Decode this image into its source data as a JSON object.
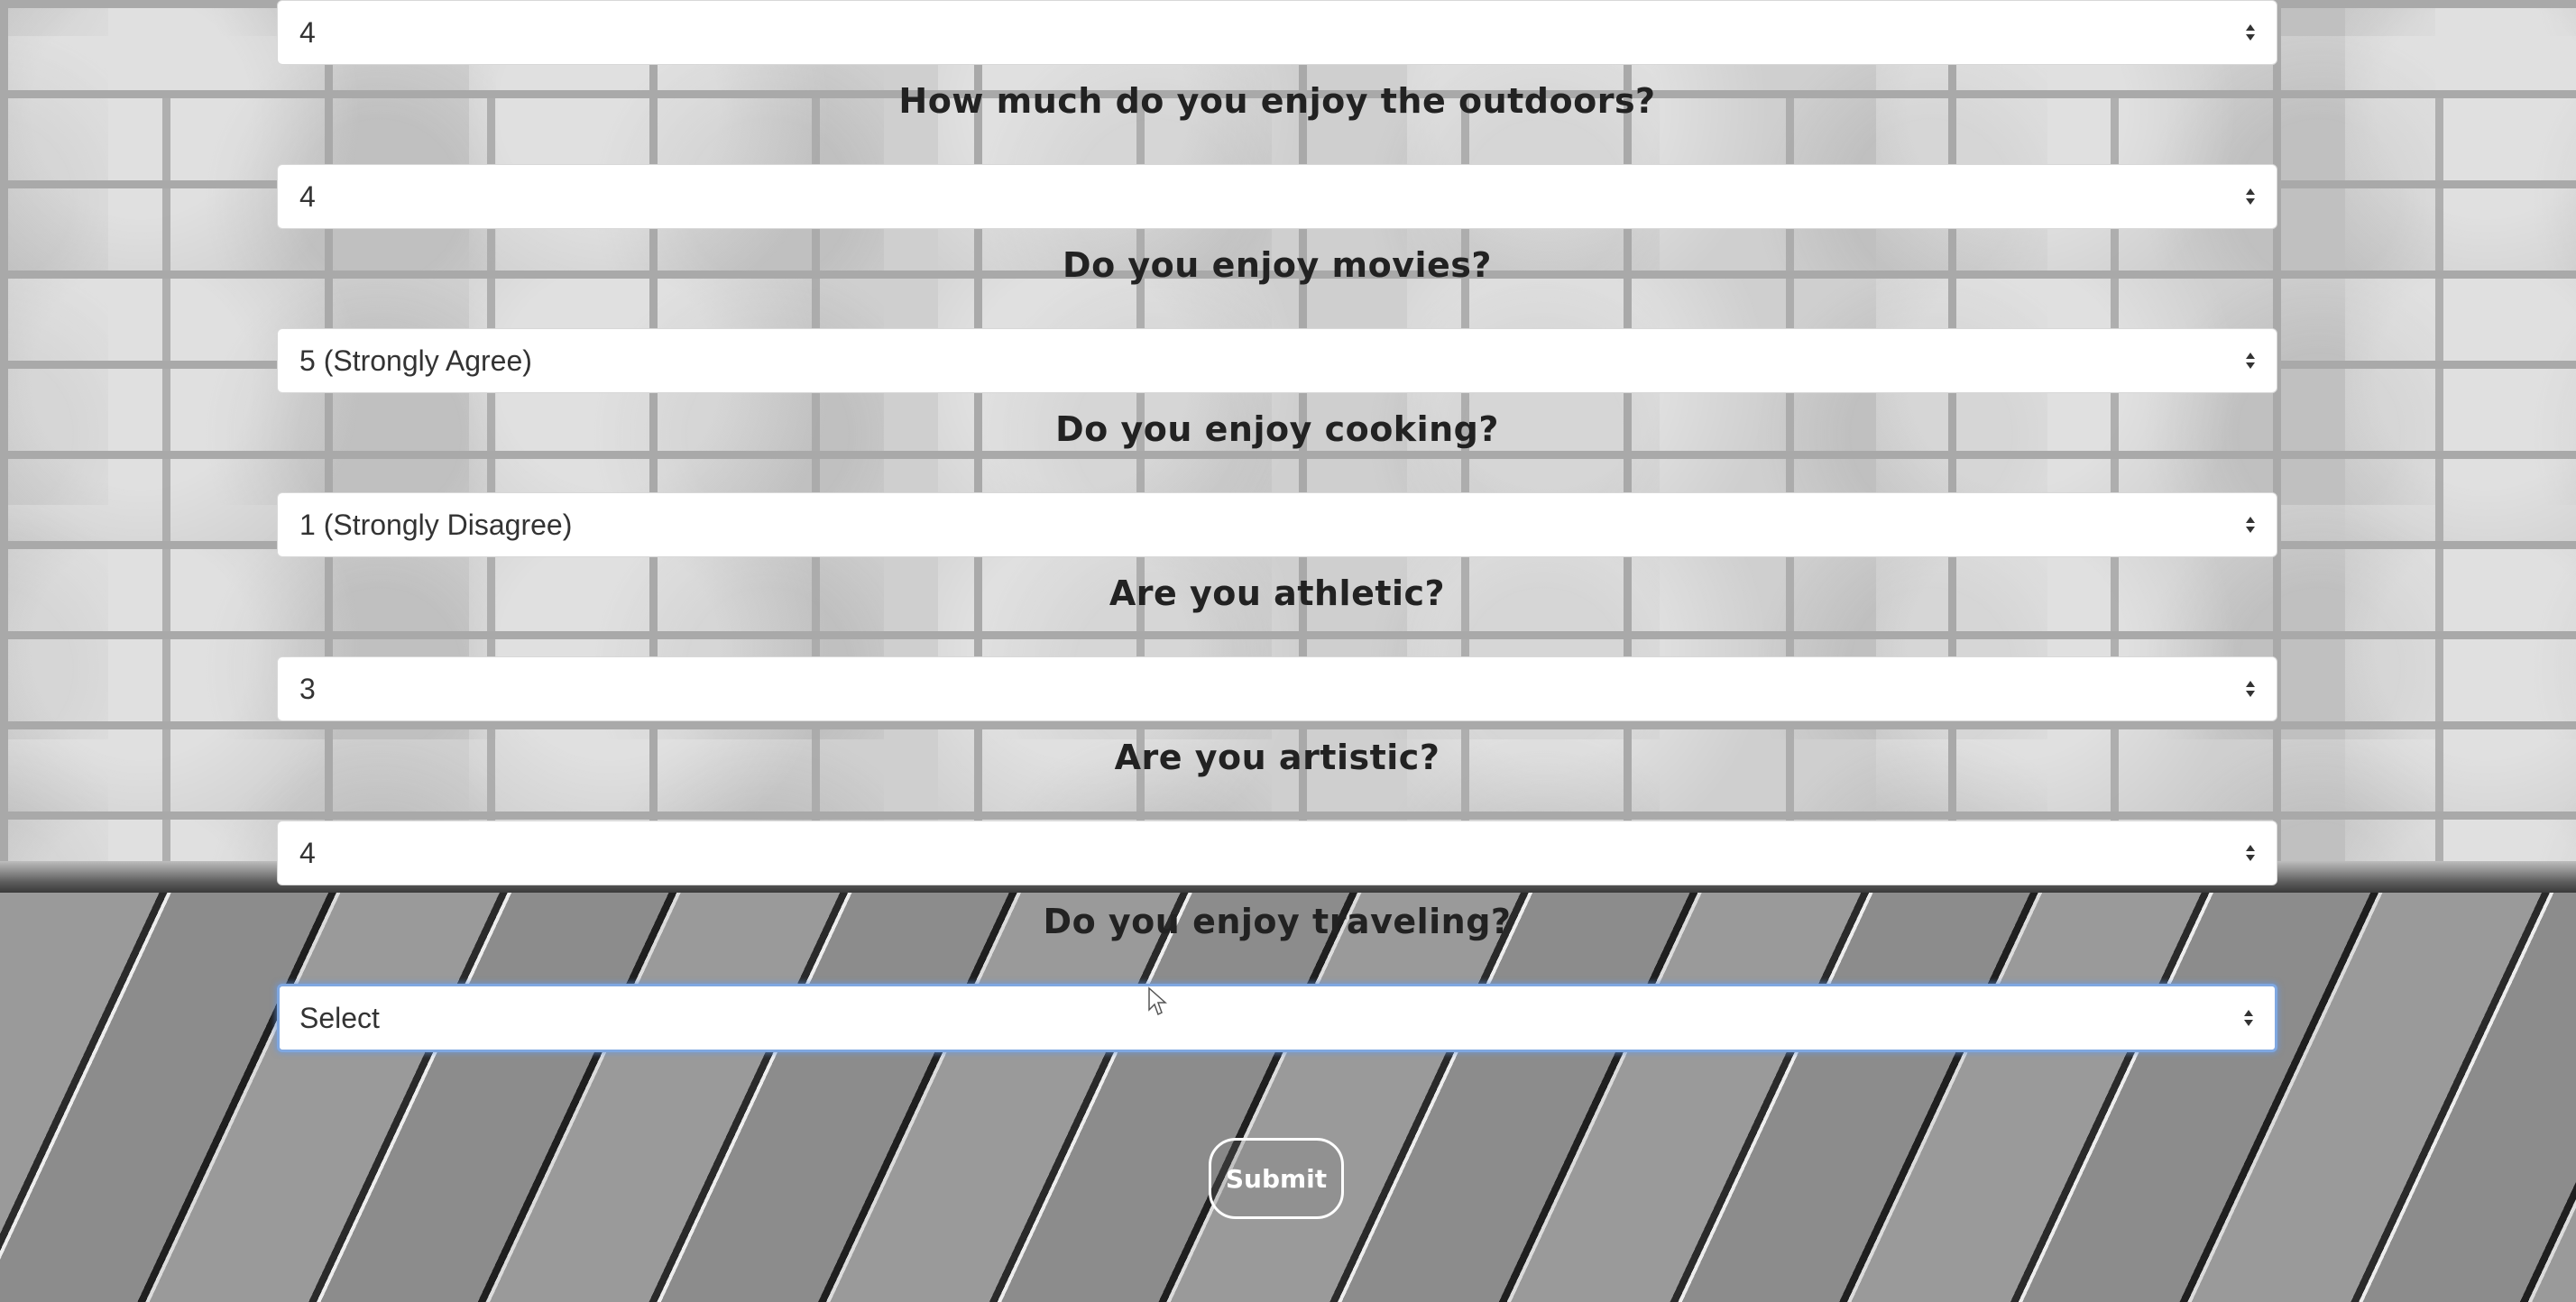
{
  "survey": {
    "first_select_value": "4",
    "questions": [
      {
        "question": "How much do you enjoy the outdoors?",
        "selected": "4"
      },
      {
        "question": "Do you enjoy movies?",
        "selected": "5 (Strongly Agree)"
      },
      {
        "question": "Do you enjoy cooking?",
        "selected": "1 (Strongly Disagree)"
      },
      {
        "question": "Are you athletic?",
        "selected": "3"
      },
      {
        "question": "Are you artistic?",
        "selected": "4"
      },
      {
        "question": "Do you enjoy traveling?",
        "selected": "Select"
      }
    ],
    "submit_label": "Submit"
  },
  "icons": {
    "select_arrow": "select-arrows-icon",
    "cursor": "mouse-pointer-icon"
  },
  "colors": {
    "focus_border": "#7fa7e0",
    "select_background": "#ffffff",
    "question_text": "#222222"
  }
}
